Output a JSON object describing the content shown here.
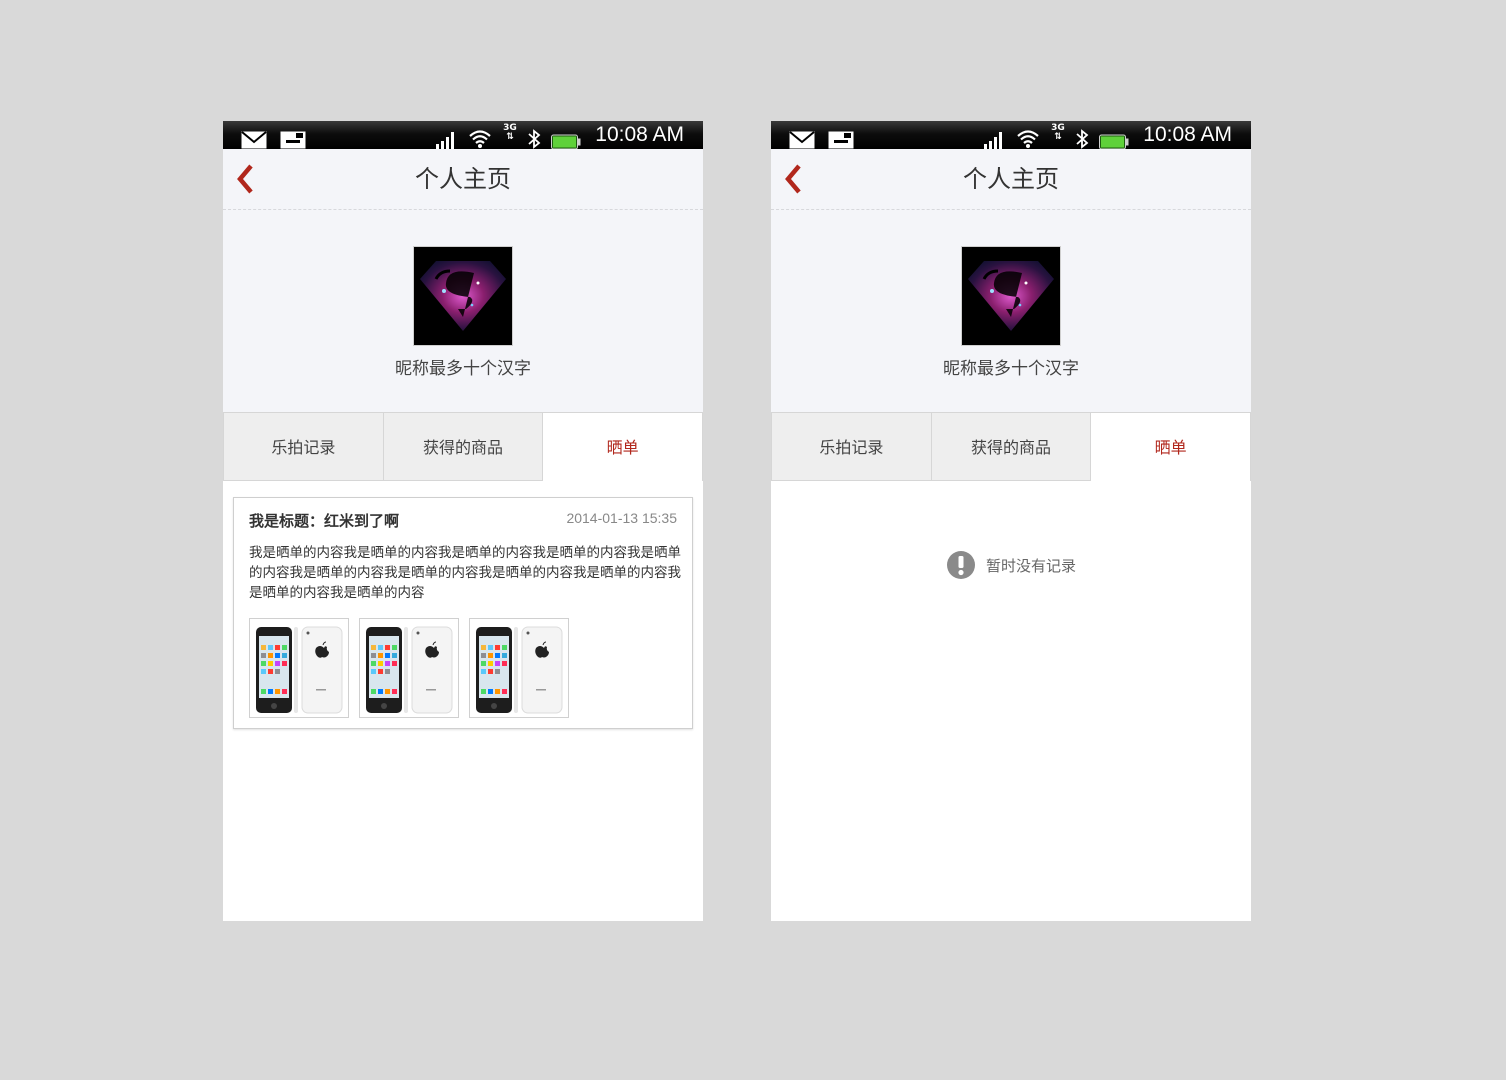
{
  "colors": {
    "accent": "#b1271c",
    "header_bg": "#f4f5f9",
    "page_bg": "#d9d9d9"
  },
  "screens": [
    {
      "status_bar": {
        "time": "10:08 AM",
        "network": "3G"
      },
      "header": {
        "back_icon": "chevron-left-icon",
        "title": "个人主页"
      },
      "profile": {
        "avatar_icon": "superman-logo-avatar",
        "nickname": "昵称最多十个汉字"
      },
      "tabs": [
        {
          "label": "乐拍记录"
        },
        {
          "label": "获得的商品"
        },
        {
          "label": "晒单",
          "active": true
        }
      ],
      "post": {
        "title": "我是标题：红米到了啊",
        "time": "2014-01-13 15:35",
        "body": "我是晒单的内容我是晒单的内容我是晒单的内容我是晒单的内容我是晒单的内容我是晒单的内容我是晒单的内容我是晒单的内容我是晒单的内容我是晒单的内容我是晒单的内容",
        "images": [
          "phone-photo-icon",
          "phone-photo-icon",
          "phone-photo-icon"
        ]
      }
    },
    {
      "status_bar": {
        "time": "10:08 AM",
        "network": "3G"
      },
      "header": {
        "back_icon": "chevron-left-icon",
        "title": "个人主页"
      },
      "profile": {
        "avatar_icon": "superman-logo-avatar",
        "nickname": "昵称最多十个汉字"
      },
      "tabs": [
        {
          "label": "乐拍记录"
        },
        {
          "label": "获得的商品"
        },
        {
          "label": "晒单",
          "active": true
        }
      ],
      "empty_state": {
        "icon": "exclamation-icon",
        "text": "暂时没有记录"
      }
    }
  ]
}
